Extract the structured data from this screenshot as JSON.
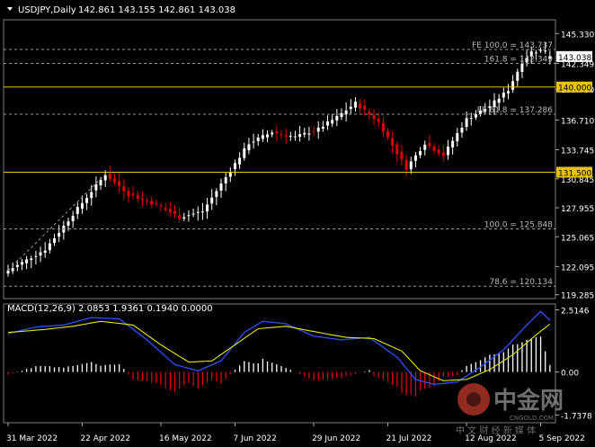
{
  "chart_data": [
    {
      "type": "candlestick",
      "title": "USDJPY,Daily",
      "ohlc": "142.861 143.155 142.861 143.038",
      "last_price": "143.038",
      "y_axis_ticks": [
        "145.330",
        "142.349",
        "139.780",
        "136.710",
        "133.745",
        "130.845",
        "127.955",
        "125.065",
        "122.095",
        "119.285"
      ],
      "y_range": [
        118.9,
        146.7
      ],
      "x_ticks": [
        "31 Mar 2022",
        "22 Apr 2022",
        "16 May 2022",
        "7 Jun 2022",
        "29 Jun 2022",
        "21 Jul 2022",
        "12 Aug 2022",
        "5 Sep 2022"
      ],
      "bar_count": 118,
      "key_points": [
        {
          "bar": 0,
          "price": 121.7
        },
        {
          "bar": 8,
          "price": 123.8
        },
        {
          "bar": 14,
          "price": 127.3
        },
        {
          "bar": 21,
          "price": 131.3
        },
        {
          "bar": 26,
          "price": 129.3
        },
        {
          "bar": 32,
          "price": 128.3
        },
        {
          "bar": 37,
          "price": 127.0
        },
        {
          "bar": 42,
          "price": 127.6
        },
        {
          "bar": 47,
          "price": 131.0
        },
        {
          "bar": 52,
          "price": 134.4
        },
        {
          "bar": 57,
          "price": 135.5
        },
        {
          "bar": 62,
          "price": 135.0
        },
        {
          "bar": 67,
          "price": 135.8
        },
        {
          "bar": 71,
          "price": 137.0
        },
        {
          "bar": 75,
          "price": 138.4
        },
        {
          "bar": 80,
          "price": 136.5
        },
        {
          "bar": 84,
          "price": 133.4
        },
        {
          "bar": 86,
          "price": 131.9
        },
        {
          "bar": 90,
          "price": 134.4
        },
        {
          "bar": 94,
          "price": 133.2
        },
        {
          "bar": 99,
          "price": 136.8
        },
        {
          "bar": 104,
          "price": 138.1
        },
        {
          "bar": 108,
          "price": 139.7
        },
        {
          "bar": 111,
          "price": 142.5
        },
        {
          "bar": 113,
          "price": 143.5
        },
        {
          "bar": 116,
          "price": 143.7
        },
        {
          "bar": 117,
          "price": 143.04
        }
      ],
      "levels": [
        {
          "price": 143.737,
          "label": "FE 100.0 = 143.737",
          "style": "dash",
          "color": "#9a9a9a"
        },
        {
          "price": 142.349,
          "label": "161.8 = 142.349",
          "style": "dash",
          "color": "#9a9a9a"
        },
        {
          "price": 140.0,
          "label": "",
          "style": "solid",
          "color": "#e6c200",
          "tag": "140.000"
        },
        {
          "price": 137.286,
          "label": "FE 61.8 = 137.286",
          "style": "dash",
          "color": "#9a9a9a"
        },
        {
          "price": 131.5,
          "label": "",
          "style": "solid",
          "color": "#e6c200",
          "tag": "131.500"
        },
        {
          "price": 125.848,
          "label": "100.0 = 125.848",
          "style": "dash",
          "color": "#9a9a9a"
        },
        {
          "price": 120.134,
          "label": "78.6 = 120.134",
          "style": "dash",
          "color": "#9a9a9a"
        }
      ],
      "colors": {
        "up": "#ffffff",
        "down": "#e00000",
        "level": "#e6c200",
        "fib": "#9a9a9a"
      }
    },
    {
      "type": "macd",
      "title": "MACD(12,26,9) 2.0853 1.9361 0.1940 0.0000",
      "y_axis_ticks": [
        "2.5146",
        "0.00",
        "-1.7378"
      ],
      "y_range": [
        -2.05,
        2.75
      ],
      "macd_key_points": [
        {
          "bar": 0,
          "v": 1.55
        },
        {
          "bar": 6,
          "v": 1.82
        },
        {
          "bar": 12,
          "v": 1.9
        },
        {
          "bar": 18,
          "v": 2.2
        },
        {
          "bar": 24,
          "v": 2.15
        },
        {
          "bar": 30,
          "v": 1.3
        },
        {
          "bar": 36,
          "v": 0.3
        },
        {
          "bar": 41,
          "v": 0.05
        },
        {
          "bar": 46,
          "v": 0.45
        },
        {
          "bar": 51,
          "v": 1.6
        },
        {
          "bar": 55,
          "v": 2.05
        },
        {
          "bar": 60,
          "v": 1.95
        },
        {
          "bar": 66,
          "v": 1.45
        },
        {
          "bar": 72,
          "v": 1.3
        },
        {
          "bar": 78,
          "v": 1.4
        },
        {
          "bar": 84,
          "v": 0.6
        },
        {
          "bar": 88,
          "v": -0.3
        },
        {
          "bar": 92,
          "v": -0.5
        },
        {
          "bar": 97,
          "v": -0.4
        },
        {
          "bar": 102,
          "v": 0.2
        },
        {
          "bar": 107,
          "v": 0.9
        },
        {
          "bar": 112,
          "v": 1.9
        },
        {
          "bar": 115,
          "v": 2.45
        },
        {
          "bar": 117,
          "v": 2.09
        }
      ],
      "signal_key_points": [
        {
          "bar": 0,
          "v": 1.6
        },
        {
          "bar": 8,
          "v": 1.72
        },
        {
          "bar": 14,
          "v": 1.85
        },
        {
          "bar": 20,
          "v": 2.05
        },
        {
          "bar": 27,
          "v": 1.9
        },
        {
          "bar": 33,
          "v": 1.1
        },
        {
          "bar": 39,
          "v": 0.4
        },
        {
          "bar": 44,
          "v": 0.45
        },
        {
          "bar": 49,
          "v": 1.1
        },
        {
          "bar": 54,
          "v": 1.75
        },
        {
          "bar": 60,
          "v": 1.85
        },
        {
          "bar": 67,
          "v": 1.6
        },
        {
          "bar": 73,
          "v": 1.4
        },
        {
          "bar": 79,
          "v": 1.35
        },
        {
          "bar": 85,
          "v": 0.85
        },
        {
          "bar": 89,
          "v": 0.05
        },
        {
          "bar": 94,
          "v": -0.35
        },
        {
          "bar": 99,
          "v": -0.3
        },
        {
          "bar": 104,
          "v": 0.1
        },
        {
          "bar": 109,
          "v": 0.7
        },
        {
          "bar": 114,
          "v": 1.5
        },
        {
          "bar": 117,
          "v": 1.94
        }
      ],
      "colors": {
        "macd": "#2b4fff",
        "signal": "#e6e600",
        "hist_pos": "#ffffff",
        "hist_neg": "#e00000"
      }
    }
  ],
  "watermark": {
    "text": "中金网",
    "sub": "CNGOLD.COM",
    "tagline": "中 文 财 经 新 媒 体",
    "brand_color": "#c0392b"
  }
}
